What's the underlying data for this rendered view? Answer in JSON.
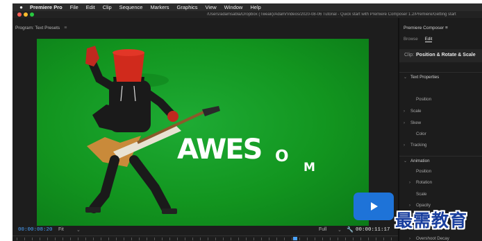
{
  "menubar": {
    "apple_icon": "apple-logo-icon",
    "items": [
      {
        "label": "Premiere Pro",
        "bold": true
      },
      {
        "label": "File"
      },
      {
        "label": "Edit"
      },
      {
        "label": "Clip"
      },
      {
        "label": "Sequence"
      },
      {
        "label": "Markers"
      },
      {
        "label": "Graphics"
      },
      {
        "label": "View"
      },
      {
        "label": "Window"
      },
      {
        "label": "Help"
      }
    ]
  },
  "titlebar": {
    "lights": [
      "#fe5f57",
      "#febc2e",
      "#28c840"
    ],
    "path": "/Users/adamsabla/Dropbox (Tweak)/Adam/Videos/2020-08-06 Tutorial - Quick start with Premiere Composer 1.2/Premiere/Getting start"
  },
  "monitor": {
    "title": "Program: Text Presets",
    "menu_icon": "panel-menu-icon",
    "overlay_word": "AWES",
    "overlay_o": "O",
    "overlay_m": "M",
    "play_icon": "play-icon",
    "play_color": "#1e73d8",
    "timecode_in": "00:00:08:20",
    "fit": "Fit",
    "quality": "Full",
    "settings_icon": "wrench-icon",
    "timecode_out": "00:00:11:17"
  },
  "side_panel": {
    "title": "Premiere Composer",
    "tabs": [
      {
        "label": "Browse",
        "active": false
      },
      {
        "label": "Edit",
        "active": true
      }
    ],
    "clip_prefix": "Clip:",
    "clip_name": "Position & Rotate & Scale",
    "props": [
      {
        "label": "Text Properties",
        "chevron": "down",
        "section": true
      },
      {
        "label": "Position",
        "chevron": "none",
        "section": false
      },
      {
        "label": "Scale",
        "chevron": "right",
        "section": false
      },
      {
        "label": "Skew",
        "chevron": "right",
        "section": false
      },
      {
        "label": "Color",
        "chevron": "none",
        "section": false
      },
      {
        "label": "Tracking",
        "chevron": "right",
        "section": false
      },
      {
        "label": "Animation",
        "chevron": "down",
        "section": true
      },
      {
        "label": "Position",
        "chevron": "none",
        "section": false
      },
      {
        "label": "Rotation",
        "chevron": "right",
        "section": false
      },
      {
        "label": "Scale",
        "chevron": "none",
        "section": false
      },
      {
        "label": "Opacity",
        "chevron": "right",
        "section": false
      },
      {
        "label": "Overshoot Decay",
        "chevron": "right",
        "section": false
      }
    ]
  },
  "watermark": "最需教育"
}
